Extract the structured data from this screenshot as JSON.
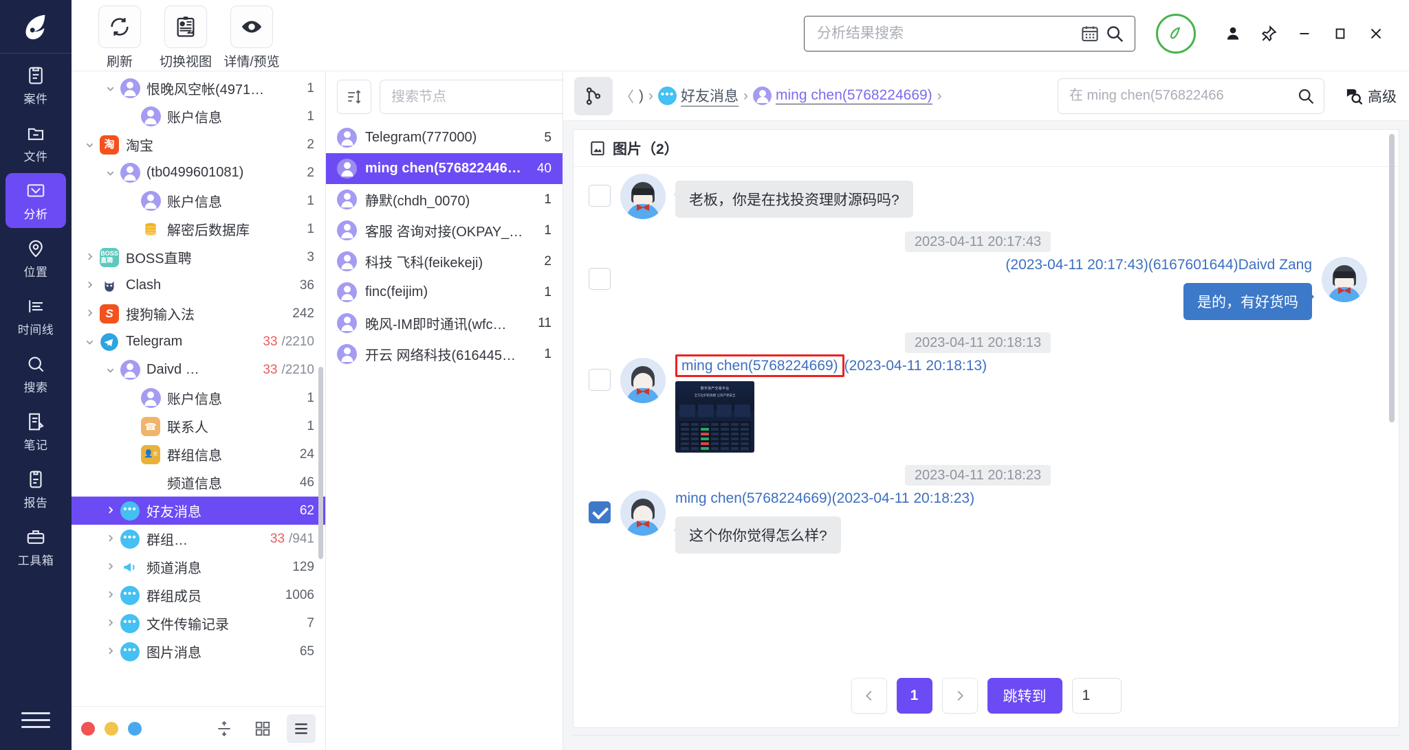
{
  "rail": {
    "logo_icon": "app-logo-icon",
    "items": [
      {
        "label": "案件",
        "icon": "case-icon",
        "active": false
      },
      {
        "label": "文件",
        "icon": "folder-icon",
        "active": false
      },
      {
        "label": "分析",
        "icon": "analysis-icon",
        "active": true
      },
      {
        "label": "位置",
        "icon": "location-icon",
        "active": false
      },
      {
        "label": "时间线",
        "icon": "timeline-icon",
        "active": false
      },
      {
        "label": "搜索",
        "icon": "search-icon",
        "active": false
      },
      {
        "label": "笔记",
        "icon": "note-icon",
        "active": false
      },
      {
        "label": "报告",
        "icon": "report-icon",
        "active": false
      },
      {
        "label": "工具箱",
        "icon": "toolbox-icon",
        "active": false
      }
    ],
    "menu_icon": "hamburger-menu-icon"
  },
  "toolbar": {
    "buttons": [
      {
        "label": "刷新",
        "icon": "refresh-icon"
      },
      {
        "label": "切换视图",
        "icon": "switch-view-icon"
      },
      {
        "label": "详情/预览",
        "icon": "eye-preview-icon"
      }
    ]
  },
  "top_search": {
    "placeholder": "分析结果搜索",
    "value": "",
    "calendar_icon": "calendar-icon",
    "search_icon": "search-icon"
  },
  "window": {
    "location_icon": "location-pin-badge-icon",
    "location_color": "#46b34b",
    "user_icon": "user-icon",
    "pin_icon": "pin-icon",
    "minimize_icon": "minimize-icon",
    "maximize_icon": "maximize-icon",
    "close_icon": "close-icon"
  },
  "tree": {
    "rows": [
      {
        "indent": 1,
        "caret": "down",
        "icon": "avatar",
        "label": "恨晚风空帐(4971…",
        "count": "1"
      },
      {
        "indent": 2,
        "caret": "none",
        "icon": "avatar",
        "label": "账户信息",
        "count": "1"
      },
      {
        "indent": 0,
        "caret": "down",
        "icon": "taobao",
        "label": "淘宝",
        "count": "2"
      },
      {
        "indent": 1,
        "caret": "down",
        "icon": "avatar",
        "label": "(tb0499601081)",
        "count": "2"
      },
      {
        "indent": 2,
        "caret": "none",
        "icon": "avatar",
        "label": "账户信息",
        "count": "1"
      },
      {
        "indent": 2,
        "caret": "none",
        "icon": "db",
        "label": "解密后数据库",
        "count": "1"
      },
      {
        "indent": 0,
        "caret": "right",
        "icon": "boss",
        "label": "BOSS直聘",
        "count": "3"
      },
      {
        "indent": 0,
        "caret": "right",
        "icon": "clash",
        "label": "Clash",
        "count": "36"
      },
      {
        "indent": 0,
        "caret": "right",
        "icon": "sogou",
        "label": "搜狗输入法",
        "count": "242"
      },
      {
        "indent": 0,
        "caret": "down",
        "icon": "telegram",
        "label": "Telegram",
        "count": "33",
        "sub": "/2210",
        "count_red": true
      },
      {
        "indent": 1,
        "caret": "down",
        "icon": "avatar",
        "label": "Daivd …",
        "count": "33",
        "sub": "/2210",
        "count_red": true
      },
      {
        "indent": 2,
        "caret": "none",
        "icon": "avatar",
        "label": "账户信息",
        "count": "1"
      },
      {
        "indent": 2,
        "caret": "none",
        "icon": "contact",
        "label": "联系人",
        "count": "1"
      },
      {
        "indent": 2,
        "caret": "none",
        "icon": "groupcard",
        "label": "群组信息",
        "count": "24"
      },
      {
        "indent": 2,
        "caret": "none",
        "icon": "none",
        "label": "频道信息",
        "count": "46"
      },
      {
        "indent": 1,
        "caret": "right",
        "icon": "chat",
        "label": "好友消息",
        "count": "62",
        "selected": true
      },
      {
        "indent": 1,
        "caret": "right",
        "icon": "chat",
        "label": "群组…",
        "count": "33",
        "sub": "/941",
        "count_red": true
      },
      {
        "indent": 1,
        "caret": "right",
        "icon": "channel",
        "label": "频道消息",
        "count": "129"
      },
      {
        "indent": 1,
        "caret": "right",
        "icon": "chat",
        "label": "群组成员",
        "count": "1006"
      },
      {
        "indent": 1,
        "caret": "right",
        "icon": "chat",
        "label": "文件传输记录",
        "count": "7"
      },
      {
        "indent": 1,
        "caret": "right",
        "icon": "chat",
        "label": "图片消息",
        "count": "65"
      }
    ],
    "footer": {
      "dots": [
        "#f05454",
        "#f3c44b",
        "#4aa8f0"
      ],
      "buttons": [
        {
          "icon": "collapse-rows-icon",
          "active": false
        },
        {
          "icon": "grid-view-icon",
          "active": false
        },
        {
          "icon": "list-view-icon",
          "active": true
        }
      ]
    }
  },
  "list": {
    "sort_icon": "sort-icon",
    "search_placeholder": "搜索节点",
    "search_value": "",
    "search_icon": "search-icon",
    "rows": [
      {
        "label": "Telegram(777000)",
        "count": "5",
        "selected": false
      },
      {
        "label": "ming chen(576822446…",
        "count": "40",
        "selected": true
      },
      {
        "label": "静默(chdh_0070)",
        "count": "1",
        "selected": false
      },
      {
        "label": "客服 咨询对接(OKPAY_…",
        "count": "1",
        "selected": false
      },
      {
        "label": "科技 飞科(feikekeji)",
        "count": "2",
        "selected": false
      },
      {
        "label": "finc(feijim)",
        "count": "1",
        "selected": false
      },
      {
        "label": "晚风-IM即时通讯(wfc…",
        "count": "11",
        "selected": false
      },
      {
        "label": "开云 网络科技(616445…",
        "count": "1",
        "selected": false
      }
    ]
  },
  "detail": {
    "graph_icon": "graph-node-icon",
    "breadcrumb": [
      {
        "type": "nav-back",
        "label": "〈"
      },
      {
        "type": "text",
        "label": ")"
      },
      {
        "type": "sep",
        "label": "›"
      },
      {
        "type": "chat",
        "label": "好友消息"
      },
      {
        "type": "sep",
        "label": "›"
      },
      {
        "type": "user",
        "label": "ming chen(5768224669)"
      },
      {
        "type": "sep",
        "label": "›"
      }
    ],
    "search_placeholder": "在 ming chen(576822466",
    "search_value": "",
    "search_icon": "search-icon",
    "advanced_label": "高级",
    "advanced_icon": "advanced-search-icon",
    "card_title": "图片（2）",
    "card_icon": "image-icon",
    "messages": [
      {
        "kind": "bubble",
        "side": "left",
        "checkbox": "unchecked",
        "text": "老板，你是在找投资理财源码吗?"
      },
      {
        "kind": "timestamp",
        "text": "2023-04-11 20:17:43"
      },
      {
        "kind": "bubble",
        "side": "right",
        "checkbox": "unchecked",
        "sender": "(2023-04-11 20:17:43)(6167601644)Daivd Zang",
        "text": "是的，有好货吗"
      },
      {
        "kind": "timestamp",
        "text": "2023-04-11 20:18:13"
      },
      {
        "kind": "image",
        "side": "left",
        "checkbox": "unchecked",
        "sender_highlight": "ming chen(5768224669)",
        "sender_rest": "(2023-04-11 20:18:13)",
        "thumb_title": "数字资产交易平台",
        "thumb_sub": "全方位护航快捷  让资产更安全"
      },
      {
        "kind": "timestamp",
        "text": "2023-04-11 20:18:23"
      },
      {
        "kind": "bubble",
        "side": "left",
        "checkbox": "checked",
        "sender": "ming chen(5768224669)(2023-04-11 20:18:23)",
        "text": "这个你你觉得怎么样?"
      }
    ],
    "pager": {
      "prev_icon": "chevron-left-icon",
      "next_icon": "chevron-right-icon",
      "pages": [
        "1"
      ],
      "current_page": "1",
      "jump_label": "跳转到",
      "jump_value": "1"
    }
  },
  "colors": {
    "accent": "#6c4bf4",
    "rail_bg": "#1b2447",
    "me_bubble": "#3d79c9",
    "highlight_border": "#ee2020",
    "link": "#3d6fc0"
  }
}
